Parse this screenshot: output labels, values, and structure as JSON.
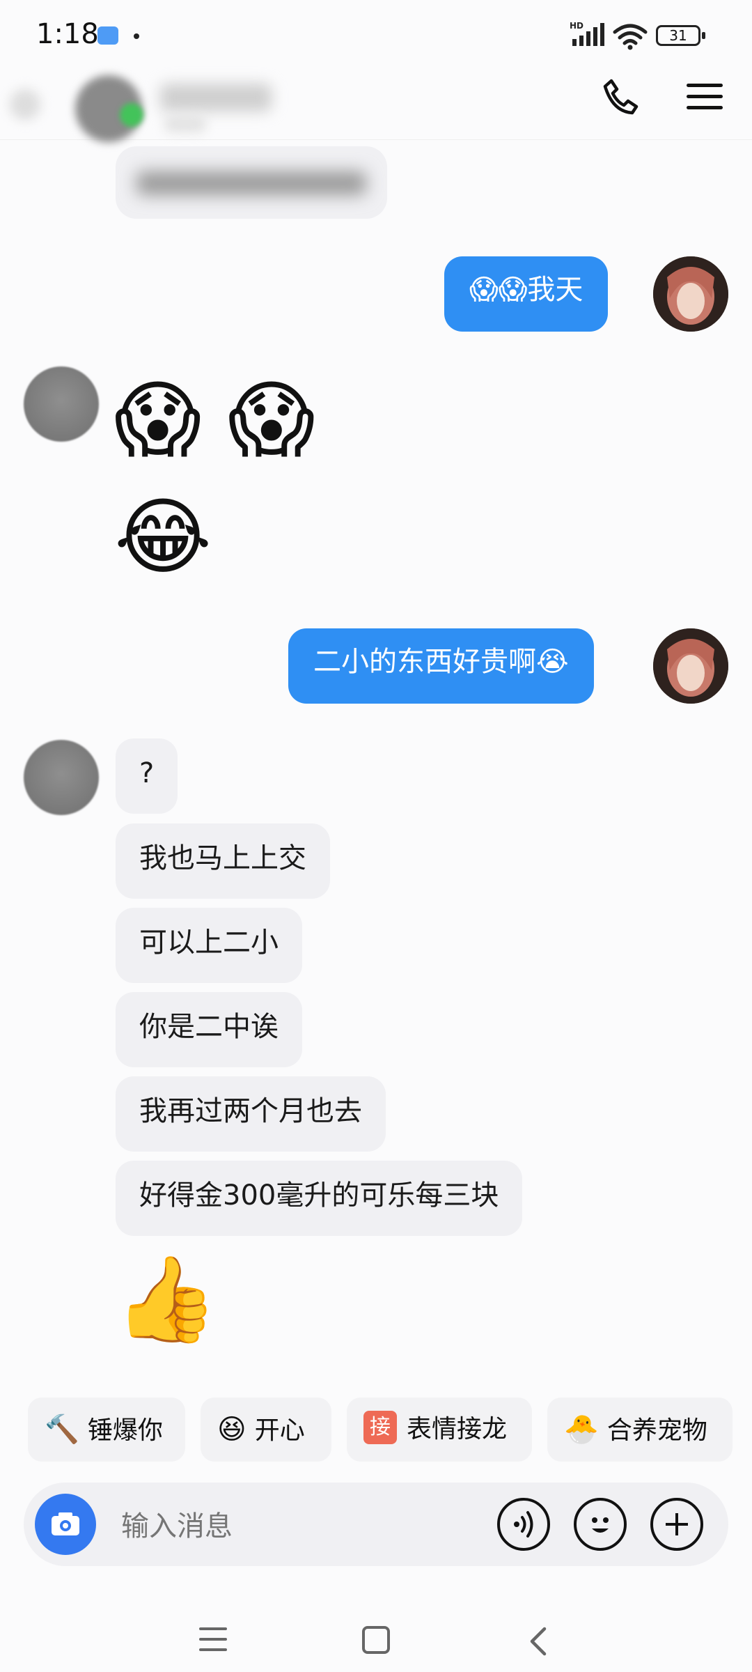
{
  "status_bar": {
    "time": "1:18",
    "network": "HD",
    "battery": "31"
  },
  "header": {
    "contact_name": "",
    "call_icon": "phone-icon",
    "menu_icon": "hamburger-menu-icon"
  },
  "messages": [
    {
      "side": "out",
      "text": "😱😱我天"
    },
    {
      "side": "in",
      "text": "😱 😱"
    },
    {
      "side": "in",
      "text": "😂"
    },
    {
      "side": "out",
      "text": "二小的东西好贵啊😭"
    },
    {
      "side": "in",
      "text": "?"
    },
    {
      "side": "in",
      "text": "我也马上上交"
    },
    {
      "side": "in",
      "text": "可以上二小"
    },
    {
      "side": "in",
      "text": "你是二中诶"
    },
    {
      "side": "in",
      "text": "我再过两个月也去"
    },
    {
      "side": "in",
      "text": "好得金300毫升的可乐每三块"
    },
    {
      "side": "in",
      "text": "👍"
    }
  ],
  "quick_replies": [
    {
      "emoji": "🔨",
      "label": "锤爆你"
    },
    {
      "emoji": "😆",
      "label": "开心"
    },
    {
      "tag": "接",
      "label": "表情接龙"
    },
    {
      "emoji": "🐣",
      "label": "合养宠物"
    }
  ],
  "input": {
    "placeholder": "输入消息"
  },
  "colors": {
    "accent": "#2f8ff3",
    "camera": "#3479f0",
    "incoming_bubble": "#f0f0f3"
  }
}
